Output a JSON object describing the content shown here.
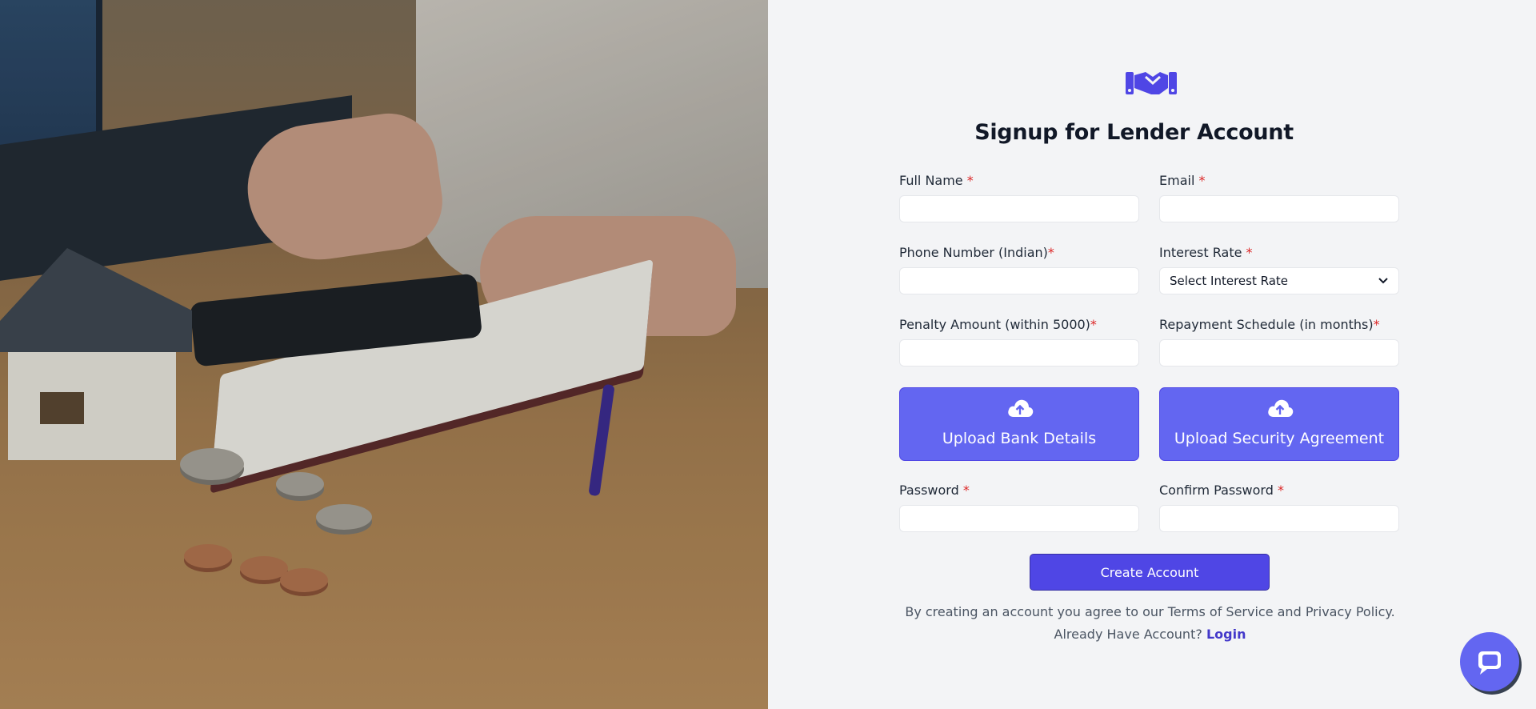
{
  "form": {
    "title": "Signup for Lender Account",
    "fields": {
      "full_name": {
        "label": "Full Name",
        "req": "*",
        "value": ""
      },
      "email": {
        "label": "Email",
        "req": "*",
        "value": ""
      },
      "phone": {
        "label": "Phone Number (Indian)",
        "req": "*",
        "value": ""
      },
      "interest_rate": {
        "label": "Interest Rate",
        "req": "*",
        "selected": "Select Interest Rate"
      },
      "penalty": {
        "label": "Penalty Amount (within 5000)",
        "req": "*",
        "value": ""
      },
      "repayment": {
        "label": "Repayment Schedule (in months)",
        "req": "*",
        "value": ""
      },
      "password": {
        "label": "Password",
        "req": "*",
        "value": ""
      },
      "confirm_password": {
        "label": "Confirm Password",
        "req": "*",
        "value": ""
      }
    },
    "uploads": {
      "bank": "Upload Bank Details",
      "security": "Upload Security Agreement"
    },
    "submit_label": "Create Account",
    "terms_text": "By creating an account you agree to our Terms of Service and Privacy Policy.",
    "login_prompt": "Already Have Account?",
    "login_link": "Login"
  },
  "icons": {
    "logo": "handshake-icon",
    "upload": "cloud-upload-icon",
    "select": "chevron-down-icon",
    "chat": "chat-bubble-icon"
  },
  "colors": {
    "accent": "#4f46e5",
    "upload_bg": "#6366f1",
    "required": "#dc2626",
    "panel_bg": "#f3f4f6"
  }
}
